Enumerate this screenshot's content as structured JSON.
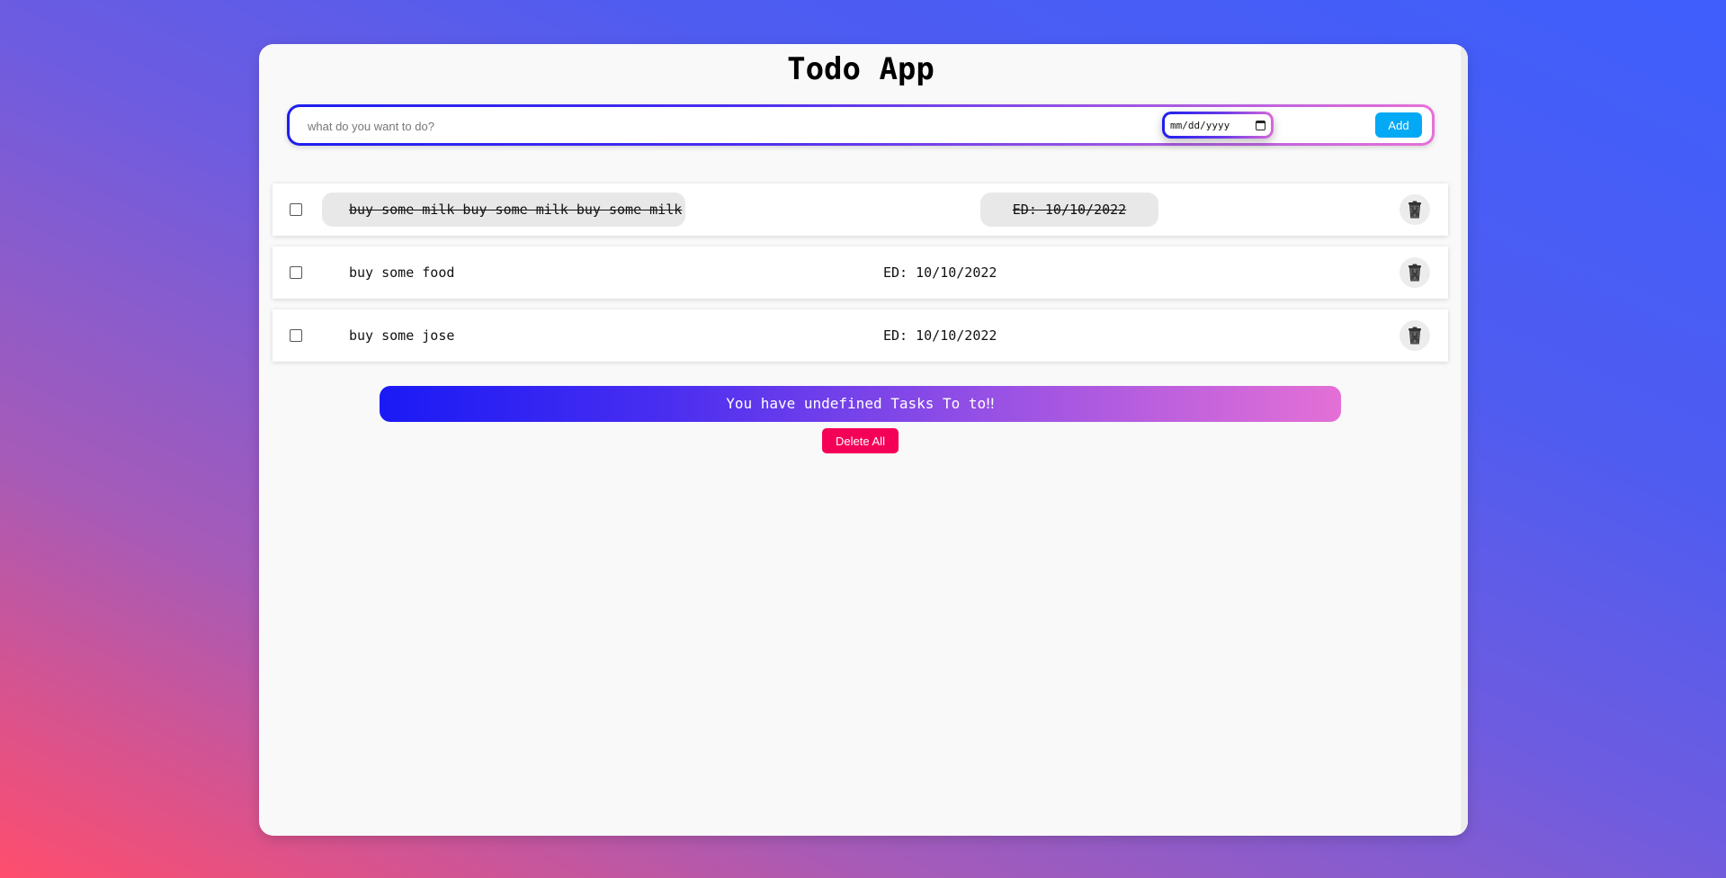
{
  "app": {
    "title": "Todo App"
  },
  "new_task": {
    "placeholder": "what do you want to do?",
    "value": "",
    "date_placeholder": "mm/dd/yyyy",
    "add_label": "Add"
  },
  "todos": [
    {
      "text": "buy some milk buy some milk buy some milk",
      "date": "ED: 10/10/2022",
      "completed": true
    },
    {
      "text": "buy some food",
      "date": "ED: 10/10/2022",
      "completed": false
    },
    {
      "text": "buy some jose",
      "date": "ED: 10/10/2022",
      "completed": false
    }
  ],
  "summary": {
    "text": "You have undefined Tasks To to‼"
  },
  "delete_all_label": "Delete All",
  "icons": {
    "delete": "trash-icon",
    "date": "calendar-icon"
  },
  "colors": {
    "add_button": "#03a9f4",
    "delete_all_button": "#f50057",
    "gradient_start": "#1a1af5",
    "gradient_end": "#e470d6"
  }
}
